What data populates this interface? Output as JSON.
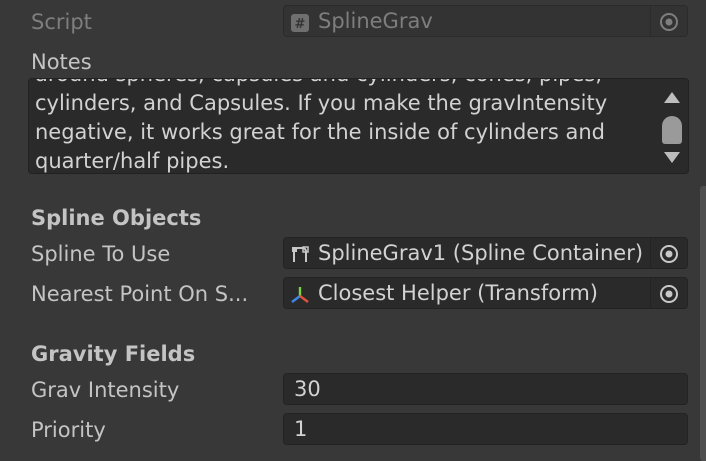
{
  "script_row": {
    "label": "Script",
    "value": "SplineGrav",
    "icon": "csharp-script-icon"
  },
  "notes": {
    "label": "Notes",
    "text_line_partial": "around spheres, capsules and cylinders, cones, pipes,",
    "text": "cylinders, and Capsules. If you make the gravIntensity\nnegative, it works great for the inside of cylinders and\nquarter/half pipes."
  },
  "spline_objects": {
    "header": "Spline Objects",
    "spline_to_use": {
      "label": "Spline To Use",
      "value": "SplineGrav1 (Spline Container)",
      "icon": "spline-container-icon"
    },
    "nearest_point": {
      "label": "Nearest Point On S...",
      "value": "Closest Helper (Transform)",
      "icon": "transform-axes-icon"
    }
  },
  "gravity_fields": {
    "header": "Gravity Fields",
    "grav_intensity": {
      "label": "Grav Intensity",
      "value": "30"
    },
    "priority": {
      "label": "Priority",
      "value": "1"
    }
  },
  "colors": {
    "background": "#383838",
    "field_bg": "#2a2a2a",
    "text": "#c4c4c4",
    "disabled_text": "#7e7e7e"
  }
}
